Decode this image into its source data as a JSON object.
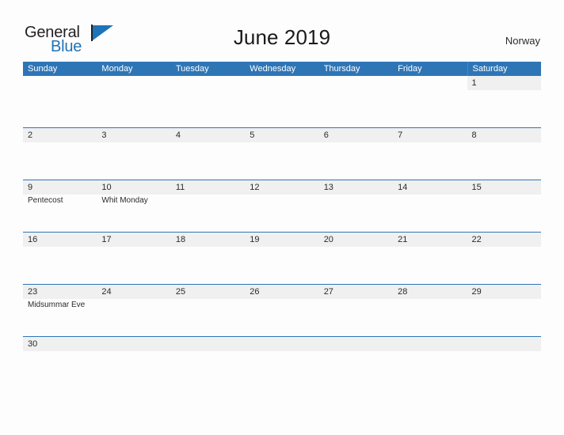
{
  "brand": {
    "name_part1": "General",
    "name_part2": "Blue",
    "flag_icon": "flag-icon",
    "color_primary": "#1f73b7",
    "color_dark": "#231f20"
  },
  "header": {
    "title": "June 2019",
    "country": "Norway"
  },
  "theme": {
    "header_blue": "#2e75b6",
    "row_divider_blue": "#2e75b6",
    "date_band_gray": "#f0f0f0",
    "page_background": "#fdfdfd",
    "text_dark": "#2b2b2b"
  },
  "calendar": {
    "month": "June",
    "year": "2019",
    "weekday_headers": [
      "Sunday",
      "Monday",
      "Tuesday",
      "Wednesday",
      "Thursday",
      "Friday",
      "Saturday"
    ],
    "weeks": [
      {
        "days": [
          {
            "date": "",
            "event": ""
          },
          {
            "date": "",
            "event": ""
          },
          {
            "date": "",
            "event": ""
          },
          {
            "date": "",
            "event": ""
          },
          {
            "date": "",
            "event": ""
          },
          {
            "date": "",
            "event": ""
          },
          {
            "date": "1",
            "event": ""
          }
        ]
      },
      {
        "days": [
          {
            "date": "2",
            "event": ""
          },
          {
            "date": "3",
            "event": ""
          },
          {
            "date": "4",
            "event": ""
          },
          {
            "date": "5",
            "event": ""
          },
          {
            "date": "6",
            "event": ""
          },
          {
            "date": "7",
            "event": ""
          },
          {
            "date": "8",
            "event": ""
          }
        ]
      },
      {
        "days": [
          {
            "date": "9",
            "event": "Pentecost"
          },
          {
            "date": "10",
            "event": "Whit Monday"
          },
          {
            "date": "11",
            "event": ""
          },
          {
            "date": "12",
            "event": ""
          },
          {
            "date": "13",
            "event": ""
          },
          {
            "date": "14",
            "event": ""
          },
          {
            "date": "15",
            "event": ""
          }
        ]
      },
      {
        "days": [
          {
            "date": "16",
            "event": ""
          },
          {
            "date": "17",
            "event": ""
          },
          {
            "date": "18",
            "event": ""
          },
          {
            "date": "19",
            "event": ""
          },
          {
            "date": "20",
            "event": ""
          },
          {
            "date": "21",
            "event": ""
          },
          {
            "date": "22",
            "event": ""
          }
        ]
      },
      {
        "days": [
          {
            "date": "23",
            "event": "Midsummar Eve"
          },
          {
            "date": "24",
            "event": ""
          },
          {
            "date": "25",
            "event": ""
          },
          {
            "date": "26",
            "event": ""
          },
          {
            "date": "27",
            "event": ""
          },
          {
            "date": "28",
            "event": ""
          },
          {
            "date": "29",
            "event": ""
          }
        ]
      },
      {
        "days": [
          {
            "date": "30",
            "event": ""
          },
          {
            "date": "",
            "event": ""
          },
          {
            "date": "",
            "event": ""
          },
          {
            "date": "",
            "event": ""
          },
          {
            "date": "",
            "event": ""
          },
          {
            "date": "",
            "event": ""
          },
          {
            "date": "",
            "event": ""
          }
        ]
      }
    ]
  }
}
